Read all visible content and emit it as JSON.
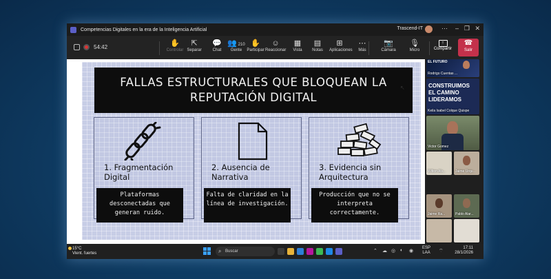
{
  "window": {
    "title": "Competencias Digitales en la era de la Inteligencia Artificial",
    "org": "Trascend-IT"
  },
  "toolbar": {
    "timer": "54:42",
    "buttons": [
      {
        "label": "Controlar",
        "icon": "control-icon",
        "glyph": "✋",
        "dim": true
      },
      {
        "label": "Separar",
        "icon": "popout-icon",
        "glyph": "⇱",
        "dim": false
      },
      {
        "label": "Chat",
        "icon": "chat-icon",
        "glyph": "💬",
        "dim": false
      },
      {
        "label": "Gente",
        "icon": "people-icon",
        "glyph": "👥",
        "dim": false,
        "badge": "210"
      },
      {
        "label": "Participar",
        "icon": "raise-hand-icon",
        "glyph": "✋",
        "dim": false
      },
      {
        "label": "Reaccionar",
        "icon": "react-icon",
        "glyph": "☺",
        "dim": false
      },
      {
        "label": "Vista",
        "icon": "view-icon",
        "glyph": "▦",
        "dim": false
      },
      {
        "label": "Notas",
        "icon": "notes-icon",
        "glyph": "▤",
        "dim": false
      },
      {
        "label": "Aplicaciones",
        "icon": "apps-icon",
        "glyph": "⊞",
        "dim": false
      },
      {
        "label": "Más",
        "icon": "more-icon",
        "glyph": "⋯",
        "dim": false
      },
      {
        "label": "Cámara",
        "icon": "camera-off-icon",
        "glyph": "📷",
        "dim": false
      },
      {
        "label": "Micro",
        "icon": "mic-off-icon",
        "glyph": "🎙",
        "dim": false
      }
    ],
    "share_label": "Compartir",
    "leave_label": "Salir"
  },
  "slide": {
    "header_line1": "FALLAS ESTRUCTURALES QUE BLOQUEAN LA",
    "header_line2": "REPUTACIÓN DIGITAL",
    "cards": [
      {
        "title": "1. Fragmentación Digital",
        "body": "Plataformas desconectadas que generan ruido.",
        "icon": "broken-chain-icon"
      },
      {
        "title": "2. Ausencia de Narrativa",
        "body": "Falta de claridad en la línea de investigación.",
        "icon": "blank-document-icon"
      },
      {
        "title": "3. Evidencia sin Arquitectura",
        "body": "Producción que no se interpreta correctamente.",
        "icon": "scattered-bricks-icon"
      }
    ]
  },
  "participants": [
    {
      "name": "Rodrigo Cuentas ..."
    },
    {
      "name": "Keila Isabel Colque Quispe"
    },
    {
      "name": "Victor Gomez"
    },
    {
      "name": "Wilton Alv..."
    },
    {
      "name": "Jaime Urqu..."
    },
    {
      "name": "Jaime Ra..."
    },
    {
      "name": "Pablo Alar..."
    },
    {
      "name": ""
    },
    {
      "name": ""
    }
  ],
  "tile_texts": {
    "promo_top": "EL FUTURO",
    "promo_big": "CONSTRUIMOS EL CAMINO LIDERAMOS"
  },
  "taskbar": {
    "temp": "15°C",
    "weather": "Vient. fuertes",
    "search_placeholder": "Buscar",
    "lang1": "ESP",
    "lang2": "LAA",
    "time": "17:11",
    "date": "28/1/2026"
  },
  "colors": {
    "teams_purple": "#5b5fc7",
    "leave_red": "#c4314b",
    "slide_bg": "#c7cde6",
    "slide_dark": "#0d0d0d"
  }
}
